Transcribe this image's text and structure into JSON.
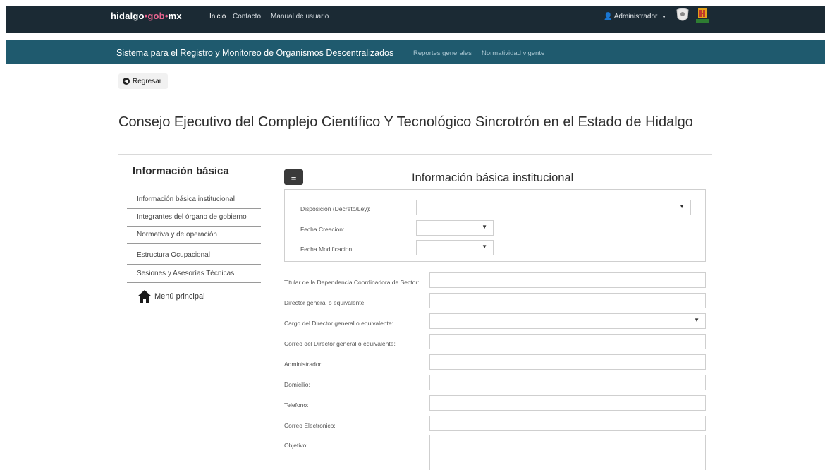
{
  "header": {
    "brand": {
      "part1": "hidalgo",
      "part2": "gob",
      "part3": "mx"
    },
    "nav": [
      {
        "label": "Inicio"
      },
      {
        "label": "Contacto"
      },
      {
        "label": "Manual de usuario"
      }
    ],
    "user": {
      "label": "Administrador"
    }
  },
  "subheader": {
    "title": "Sistema para el Registro y Monitoreo de Organismos Descentralizados",
    "links": [
      {
        "label": "Reportes generales"
      },
      {
        "label": "Normatividad vigente"
      }
    ]
  },
  "back_button": {
    "label": "Regresar"
  },
  "page_title": "Consejo Ejecutivo del Complejo Científico Y Tecnológico Sincrotrón en el Estado de Hidalgo",
  "sidebar": {
    "heading": "Información básica",
    "items": [
      {
        "label": "Información básica institucional"
      },
      {
        "label": "Integrantes del órgano de gobierno"
      },
      {
        "label": "Normativa y de operación"
      },
      {
        "label": "Estructura Ocupacional"
      },
      {
        "label": "Sesiones y Asesorías Técnicas"
      }
    ],
    "home_label": "Menú principal"
  },
  "main": {
    "section_title": "Información básica institucional",
    "panel_fields": [
      {
        "label": "Disposición (Decreto/Ley):",
        "value": ""
      },
      {
        "label": "Fecha Creacion:",
        "value": ""
      },
      {
        "label": "Fecha Modificacion:",
        "value": ""
      }
    ],
    "fields": [
      {
        "label": "Titular de la Dependencia Coordinadora de Sector:",
        "value": ""
      },
      {
        "label": "Director general o equivalente:",
        "value": ""
      },
      {
        "label": "Cargo del Director general o equivalente:",
        "value": ""
      },
      {
        "label": "Correo del Director general o equivalente:",
        "value": ""
      },
      {
        "label": "Administrador:",
        "value": ""
      },
      {
        "label": "Domicilio:",
        "value": ""
      },
      {
        "label": "Telefono:",
        "value": ""
      },
      {
        "label": "Correo Electronico:",
        "value": ""
      },
      {
        "label": "Objetivo:",
        "value": ""
      }
    ]
  },
  "colors": {
    "topbar": "#1b2a34",
    "subbar": "#1f5a6e",
    "brand_accent": "#e9658f"
  }
}
